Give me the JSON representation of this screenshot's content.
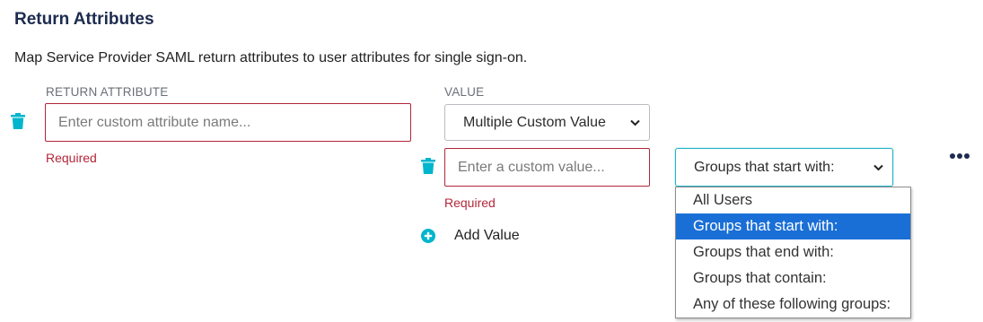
{
  "section": {
    "title": "Return Attributes",
    "description": "Map Service Provider SAML return attributes to user attributes for single sign-on."
  },
  "columns": {
    "return_attribute_label": "RETURN ATTRIBUTE",
    "value_label": "VALUE"
  },
  "attribute_row": {
    "name_placeholder": "Enter custom attribute name...",
    "name_error": "Required",
    "value_type_selected": "Multiple Custom Value",
    "value": {
      "placeholder": "Enter a custom value...",
      "error": "Required",
      "group_filter_selected": "Groups that start with:"
    }
  },
  "add_value_label": "Add Value",
  "group_filter_options": [
    "All Users",
    "Groups that start with:",
    "Groups that end with:",
    "Groups that contain:",
    "Any of these following groups:"
  ],
  "group_filter_highlighted_index": 1,
  "colors": {
    "accent": "#00b5cc",
    "error": "#b3263a",
    "selected_option_bg": "#1a6fd6",
    "title": "#1d2b4f"
  },
  "icons": [
    "trash-icon",
    "chevron-down-icon",
    "plus-circle-icon",
    "more-horizontal-icon"
  ]
}
